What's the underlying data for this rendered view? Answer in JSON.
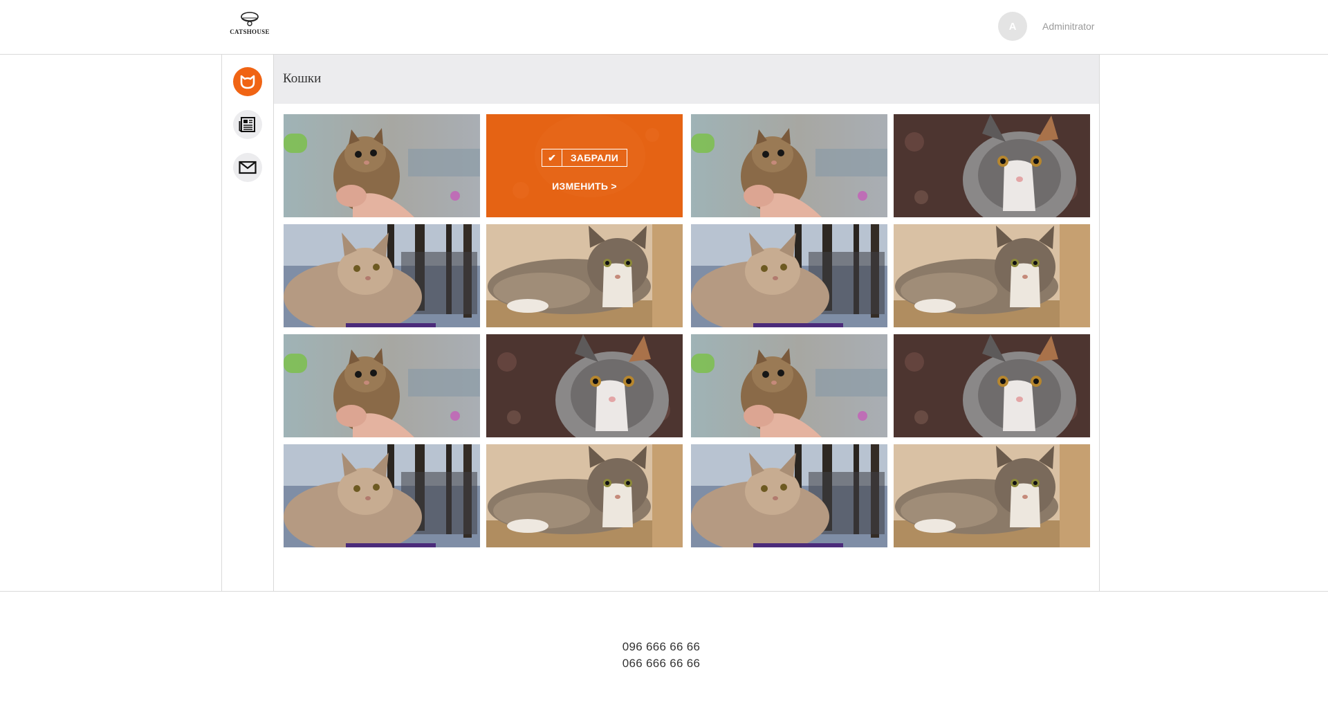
{
  "header": {
    "logo_text": "CATSHOUSE",
    "user": {
      "avatar_letter": "A",
      "name": "Adminitrator"
    }
  },
  "sidebar": {
    "items": [
      {
        "icon": "cat-face-icon",
        "active": true
      },
      {
        "icon": "newspaper-icon",
        "active": false
      },
      {
        "icon": "envelope-icon",
        "active": false
      }
    ]
  },
  "main": {
    "title": "Кошки",
    "grid": {
      "rows": [
        [
          "kitten-in-hand",
          "orange-cat-taken",
          "kitten-in-hand",
          "calico-cat"
        ],
        [
          "fluffy-cat-outdoors",
          "lying-maine-coon",
          "fluffy-cat-outdoors",
          "lying-maine-coon"
        ],
        [
          "kitten-in-hand",
          "calico-cat",
          "kitten-in-hand",
          "calico-cat"
        ],
        [
          "fluffy-cat-outdoors",
          "lying-maine-coon",
          "fluffy-cat-outdoors",
          "lying-maine-coon"
        ]
      ],
      "overlay": {
        "status_label": "ЗАБРАЛИ",
        "edit_label": "ИЗМЕНИТЬ >"
      }
    }
  },
  "footer": {
    "phones": [
      "096 666 66 66",
      "066 666 66 66"
    ]
  },
  "colors": {
    "accent": "#f06414",
    "header_bar": "#ececee",
    "border": "#d9d9d9"
  }
}
